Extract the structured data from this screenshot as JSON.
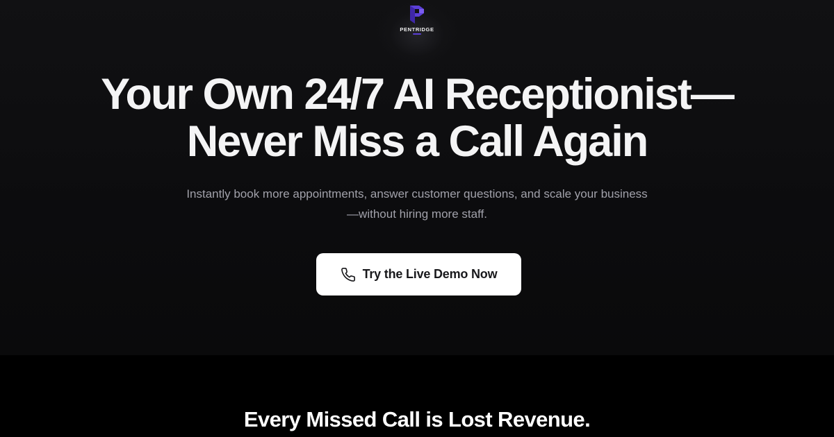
{
  "brand": {
    "name": "PENTRIDGE",
    "logo_icon": "pentridge-p-logo-icon",
    "accent_color": "#5b3fd6"
  },
  "hero": {
    "headline_line1": "Your Own 24/7 AI Receptionist—",
    "headline_line2": "Never Miss a Call Again",
    "subhead_line1": "Instantly book more appointments, answer customer questions, and scale your business",
    "subhead_line2": "—without hiring more staff.",
    "cta_label": "Try the Live Demo Now",
    "cta_icon": "phone-icon"
  },
  "next_section": {
    "title": "Every Missed Call is Lost Revenue."
  },
  "colors": {
    "background": "#000000",
    "hero_background": "#0e0e10",
    "headline": "#f4f4f5",
    "subhead": "#a1a1aa",
    "cta_background": "#ffffff",
    "cta_text": "#18181b"
  }
}
